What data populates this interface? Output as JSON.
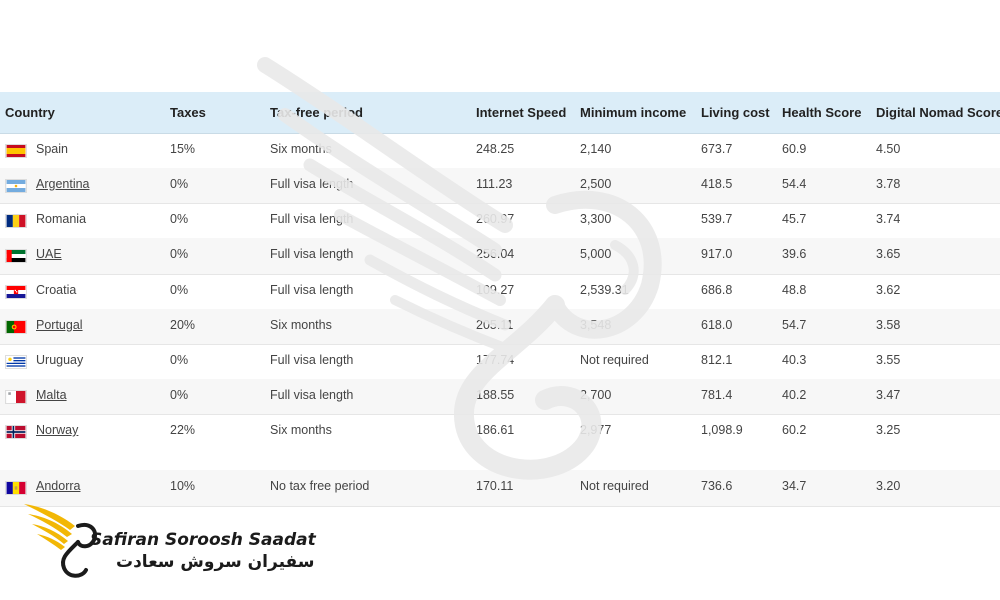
{
  "table": {
    "headers": [
      "Country",
      "Taxes",
      "Tax-free period",
      "Internet Speed",
      "Minimum income",
      "Living cost",
      "Health Score",
      "Digital Nomad Score"
    ],
    "rows": [
      {
        "country": "Spain",
        "link": false,
        "flag": "spain-flag-icon",
        "taxes": "15%",
        "period": "Six months",
        "speed": "248.25",
        "income": "2,140",
        "living": "673.7",
        "health": "60.9",
        "score": "4.50"
      },
      {
        "country": "Argentina",
        "link": true,
        "flag": "argentina-flag-icon",
        "taxes": "0%",
        "period": "Full visa length",
        "speed": "111.23",
        "income": "2,500",
        "living": "418.5",
        "health": "54.4",
        "score": "3.78"
      },
      {
        "country": "Romania",
        "link": false,
        "flag": "romania-flag-icon",
        "taxes": "0%",
        "period": "Full visa length",
        "speed": "260.97",
        "income": "3,300",
        "living": "539.7",
        "health": "45.7",
        "score": "3.74"
      },
      {
        "country": "UAE",
        "link": true,
        "flag": "uae-flag-icon",
        "taxes": "0%",
        "period": "Full visa length",
        "speed": "256.04",
        "income": "5,000",
        "living": "917.0",
        "health": "39.6",
        "score": "3.65"
      },
      {
        "country": "Croatia",
        "link": false,
        "flag": "croatia-flag-icon",
        "taxes": "0%",
        "period": "Full visa length",
        "speed": "109.27",
        "income": "2,539.31",
        "living": "686.8",
        "health": "48.8",
        "score": "3.62"
      },
      {
        "country": "Portugal",
        "link": true,
        "flag": "portugal-flag-icon",
        "taxes": "20%",
        "period": "Six months",
        "speed": "205.11",
        "income": "3,548",
        "living": "618.0",
        "health": "54.7",
        "score": "3.58"
      },
      {
        "country": "Uruguay",
        "link": false,
        "flag": "uruguay-flag-icon",
        "taxes": "0%",
        "period": "Full visa length",
        "speed": "177.74",
        "income": "Not required",
        "living": "812.1",
        "health": "40.3",
        "score": "3.55"
      },
      {
        "country": "Malta",
        "link": true,
        "flag": "malta-flag-icon",
        "taxes": "0%",
        "period": "Full visa length",
        "speed": "188.55",
        "income": "2,700",
        "living": "781.4",
        "health": "40.2",
        "score": "3.47"
      },
      {
        "country": "Norway",
        "link": true,
        "flag": "norway-flag-icon",
        "taxes": "22%",
        "period": "Six months",
        "speed": "186.61",
        "income": "2,977",
        "living": "1,098.9",
        "health": "60.2",
        "score": "3.25"
      },
      {
        "country": "Andorra",
        "link": true,
        "flag": "andorra-flag-icon",
        "taxes": "10%",
        "period": "No tax free period",
        "speed": "170.11",
        "income": "Not required",
        "living": "736.6",
        "health": "34.7",
        "score": "3.20"
      }
    ]
  },
  "logo": {
    "name_en": "Safiran Soroosh Saadat",
    "name_fa": "سفیران سروش سعادت",
    "icon": "wing-logo-icon",
    "accent": "#f2b705"
  },
  "watermark": {
    "icon": "wing-watermark-icon"
  }
}
